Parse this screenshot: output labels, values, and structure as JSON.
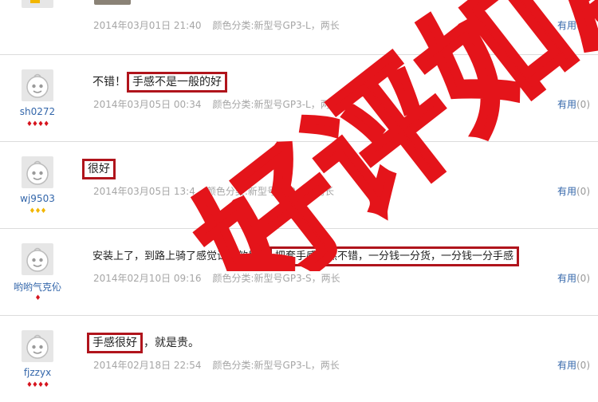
{
  "reviews": [
    {
      "comment_pre": "",
      "comment_hl": "",
      "comment_post": "",
      "date": "2014年03月01日 21:40",
      "sku": "颜色分类:新型号GP3-L，两长",
      "useful_label": "有用",
      "useful_count": "(0)"
    },
    {
      "username": "sh0272",
      "badges": "♦♦♦♦",
      "badge_color": "#d6141e",
      "comment_pre": "不错！",
      "comment_hl": "手感不是一般的好",
      "comment_post": "",
      "date": "2014年03月05日 00:34",
      "sku": "颜色分类:新型号GP3-L，两长",
      "useful_label": "有用",
      "useful_count": "(0)"
    },
    {
      "username": "wj9503",
      "badges": "♦♦♦",
      "badge_color": "#f2b600",
      "comment_pre": "",
      "comment_hl": "很好",
      "comment_post": "",
      "date": "2014年03月05日 13:4",
      "sku": "颜色分类:新型号GP3-S，两长",
      "useful_label": "有用",
      "useful_count": "(0)"
    },
    {
      "username": "哟哟气克伈",
      "badges": "♦",
      "badge_color": "#d6141e",
      "comment_pre": "安装上了，到路上骑了感觉试试效果，",
      "comment_hl": "把套手感果然不错，一分钱一分货，一分钱一分手感",
      "comment_post": "",
      "date": "2014年02月10日 09:16",
      "sku": "颜色分类:新型号GP3-S，两长",
      "useful_label": "有用",
      "useful_count": "(0)"
    },
    {
      "username": "fjzzyx",
      "badges": "♦♦♦♦",
      "badge_color": "#d6141e",
      "comment_pre": "",
      "comment_hl": "手感很好",
      "comment_post": "，就是贵。",
      "date": "2014年02月18日 22:54",
      "sku": "颜色分类:新型号GP3-L，两长",
      "useful_label": "有用",
      "useful_count": "(0)"
    }
  ],
  "stamp": {
    "text": "好评如潮",
    "color": "#e4141a"
  }
}
